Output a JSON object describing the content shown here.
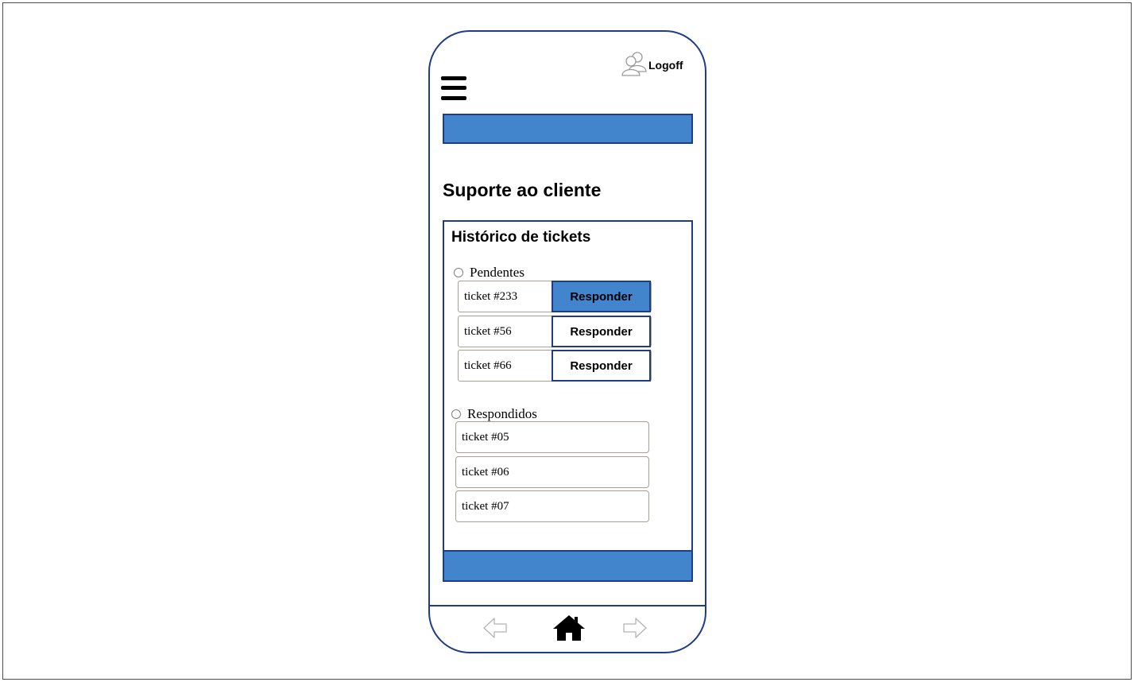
{
  "header": {
    "logoff_label": "Logoff",
    "logoff_icon": "user-group-icon",
    "menu_icon": "hamburger-menu-icon"
  },
  "page": {
    "title": "Suporte ao cliente"
  },
  "history": {
    "title": "Histórico de tickets",
    "pending": {
      "label": "Pendentes",
      "items": [
        {
          "ticket": "ticket #233",
          "action": "Responder"
        },
        {
          "ticket": "ticket #56",
          "action": "Responder"
        },
        {
          "ticket": "ticket #66",
          "action": "Responder"
        }
      ]
    },
    "answered": {
      "label": "Respondidos",
      "items": [
        {
          "ticket": "ticket #05"
        },
        {
          "ticket": "ticket #06"
        },
        {
          "ticket": "ticket #07"
        }
      ]
    }
  },
  "nav": {
    "back_icon": "arrow-left-icon",
    "home_icon": "home-icon",
    "forward_icon": "arrow-right-icon"
  },
  "colors": {
    "frame_border": "#1f3c88",
    "accent": "#4285cc",
    "row_border": "#a89f95"
  }
}
